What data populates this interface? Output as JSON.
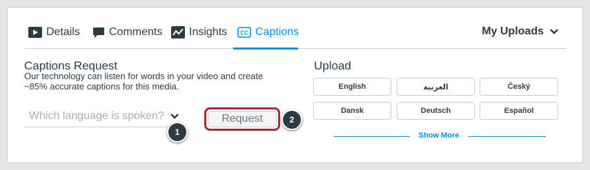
{
  "tabs": [
    {
      "label": "Details",
      "icon": "video-play-icon"
    },
    {
      "label": "Comments",
      "icon": "comment-icon"
    },
    {
      "label": "Insights",
      "icon": "insights-icon"
    },
    {
      "label": "Captions",
      "icon": "closed-captions-icon",
      "active": true
    }
  ],
  "uploads_menu": {
    "label": "My Uploads"
  },
  "captions_request": {
    "title": "Captions Request",
    "description": "Our technology can listen for words in your video and create ~85% accurate captions for this media.",
    "language_placeholder": "Which language is spoken?",
    "request_label": "Request"
  },
  "upload": {
    "title": "Upload",
    "languages": [
      "English",
      "العربية",
      "Český",
      "Dansk",
      "Deutsch",
      "Español"
    ],
    "show_more": "Show More"
  },
  "callouts": [
    "1",
    "2"
  ],
  "colors": {
    "accent": "#008ee2",
    "text": "#2d3b45",
    "highlight": "#a52a37"
  }
}
